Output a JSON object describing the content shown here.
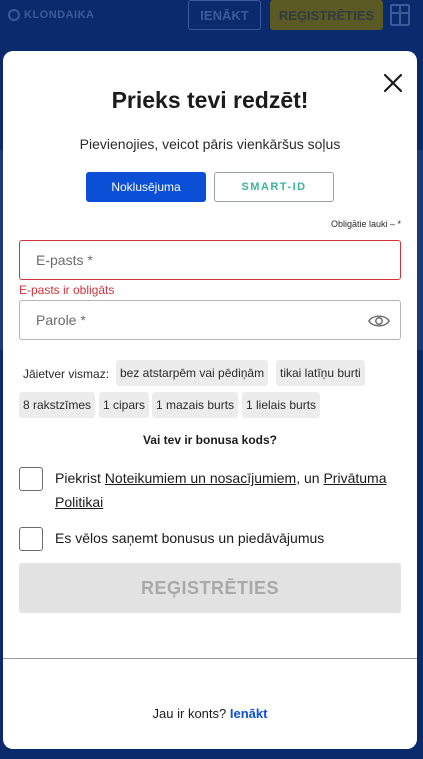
{
  "background": {
    "logo_text": "KLONDAIKA",
    "login_label": "IENĀKT",
    "register_label": "REĢISTRĒTIES",
    "gift_icon": "gift-icon"
  },
  "modal": {
    "title": "Prieks tevi redzēt!",
    "subtitle": "Pievienojies, veicot pāris vienkāršus soļus",
    "close_icon": "close-icon",
    "toggle": {
      "default_label": "Noklusējuma",
      "smart_label": "SMART-ID"
    },
    "required_note": "Obligātie lauki – *",
    "email": {
      "placeholder": "E-pasts *",
      "value": "",
      "error": "E-pasts ir obligāts"
    },
    "password": {
      "placeholder": "Parole *",
      "value": "",
      "eye_icon": "eye-icon"
    },
    "password_hints": {
      "label": "Jāietver vismaz:",
      "chips": [
        "bez atstarpēm vai pēdiņām",
        "tikai latīņu burti",
        "8 rakstzīmes",
        "1 cipars",
        "1 mazais burts",
        "1 lielais burts"
      ]
    },
    "bonus_question": "Vai tev ir bonusa kods?",
    "terms": {
      "prefix": "Piekrist ",
      "terms_link": "Noteikumiem un nosacījumiem",
      "middle": ", un ",
      "privacy_link_1": "Privātuma",
      "privacy_link_2": "Politikai"
    },
    "bonus_opt_in": "Es vēlos saņemt bonusus un piedāvājumus",
    "register_button": "REĢISTRĒTIES",
    "footer": {
      "text": "Jau ir konts? ",
      "login_link": "Ienākt"
    },
    "colors": {
      "primary": "#0b4fd6",
      "error": "#d0333a",
      "smart_id": "#3bb49a",
      "disabled_bg": "#e2e2e2"
    }
  }
}
